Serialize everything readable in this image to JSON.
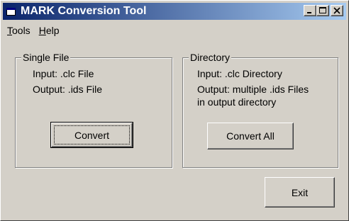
{
  "window": {
    "title": "MARK Conversion Tool"
  },
  "menu": {
    "tools_mnemonic": "T",
    "tools_rest": "ools",
    "help_mnemonic": "H",
    "help_rest": "elp"
  },
  "single": {
    "legend": "Single File",
    "input": "Input: .clc File",
    "output": "Output: .ids File",
    "button": "Convert"
  },
  "directory": {
    "legend": "Directory",
    "input": "Input: .clc Directory",
    "output_line1": "Output: multiple .ids Files",
    "output_line2": "in output directory",
    "button": "Convert All"
  },
  "exit_button": "Exit",
  "colors": {
    "titlebar_start": "#0a246a",
    "titlebar_end": "#a6caf0",
    "face": "#d4d0c8"
  }
}
